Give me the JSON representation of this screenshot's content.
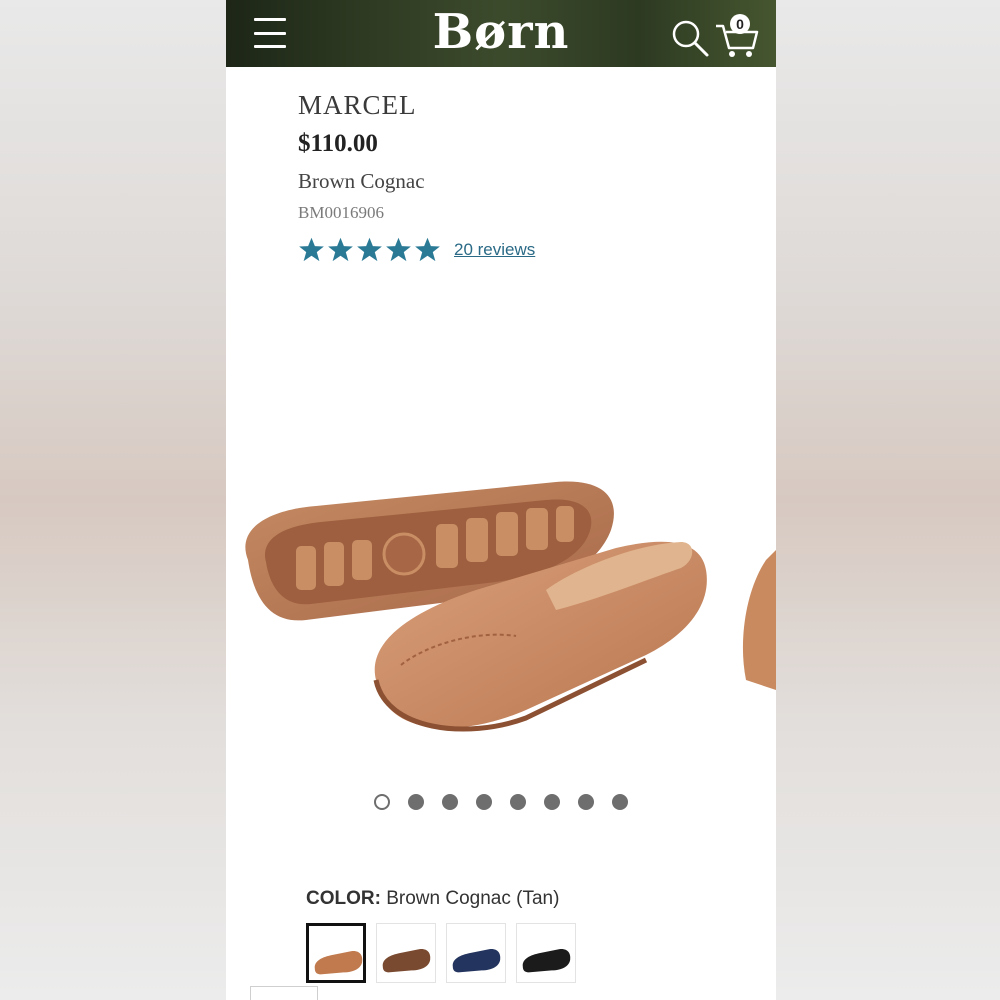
{
  "header": {
    "logo_text": "Børn",
    "menu_icon": "hamburger-menu-icon",
    "search_icon": "search-icon",
    "cart_icon": "cart-icon",
    "cart_count": "0"
  },
  "product": {
    "name": "MARCEL",
    "price": "$110.00",
    "color_name": "Brown Cognac",
    "sku": "BM0016906",
    "rating_stars": 5,
    "reviews_label": "20 reviews"
  },
  "gallery": {
    "image_count": 8,
    "active_index": 0
  },
  "color_selector": {
    "label": "COLOR:",
    "selected_value": "Brown Cognac (Tan)",
    "swatches": [
      {
        "color": "#c07a4e",
        "selected": true
      },
      {
        "color": "#7a4a30",
        "selected": false
      },
      {
        "color": "#23345e",
        "selected": false
      },
      {
        "color": "#1b1b1b",
        "selected": false
      }
    ]
  },
  "colors": {
    "star": "#2a7a96",
    "link": "#2a6a86",
    "leather": "#c98a5f"
  }
}
